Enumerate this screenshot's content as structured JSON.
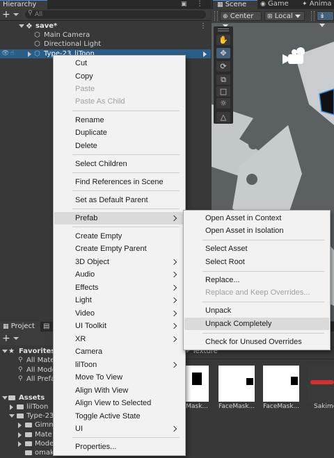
{
  "hierarchy": {
    "tab_label": "Hierarchy",
    "search_placeholder": "All",
    "add_label": "+",
    "scene_name": "save*",
    "items": [
      "Main Camera",
      "Directional Light",
      "Type-23_liToon"
    ]
  },
  "scene_view": {
    "tabs": [
      "Scene",
      "Game",
      "Anima"
    ],
    "pivot_label": "Center",
    "space_label": "Local"
  },
  "project": {
    "tab_label": "Project",
    "add_label": "+",
    "favorites_label": "Favorites",
    "favorites_items": [
      "All Mate",
      "All Mode",
      "All Prefa"
    ],
    "assets_label": "Assets",
    "assets_items": [
      "lilToon",
      "Type-23",
      "Gimm",
      "Mate",
      "Mode",
      "omak"
    ],
    "breadcrumb": "Texture",
    "thumbnails": [
      "erMask...",
      "FaceMask...",
      "FaceMask...",
      "Sakimen"
    ]
  },
  "context_menu": {
    "items": [
      "Cut",
      "Copy",
      "Paste",
      "Paste As Child",
      "Rename",
      "Duplicate",
      "Delete",
      "Select Children",
      "Find References in Scene",
      "Set as Default Parent",
      "Prefab",
      "Create Empty",
      "Create Empty Parent",
      "3D Object",
      "Audio",
      "Effects",
      "Light",
      "Video",
      "UI Toolkit",
      "XR",
      "Camera",
      "lilToon",
      "Move To View",
      "Align With View",
      "Align View to Selected",
      "Toggle Active State",
      "UI",
      "Properties..."
    ]
  },
  "prefab_submenu": {
    "items": [
      "Open Asset in Context",
      "Open Asset in Isolation",
      "Select Asset",
      "Select Root",
      "Replace...",
      "Replace and Keep Overrides...",
      "Unpack",
      "Unpack Completely",
      "Check for Unused Overrides"
    ]
  }
}
